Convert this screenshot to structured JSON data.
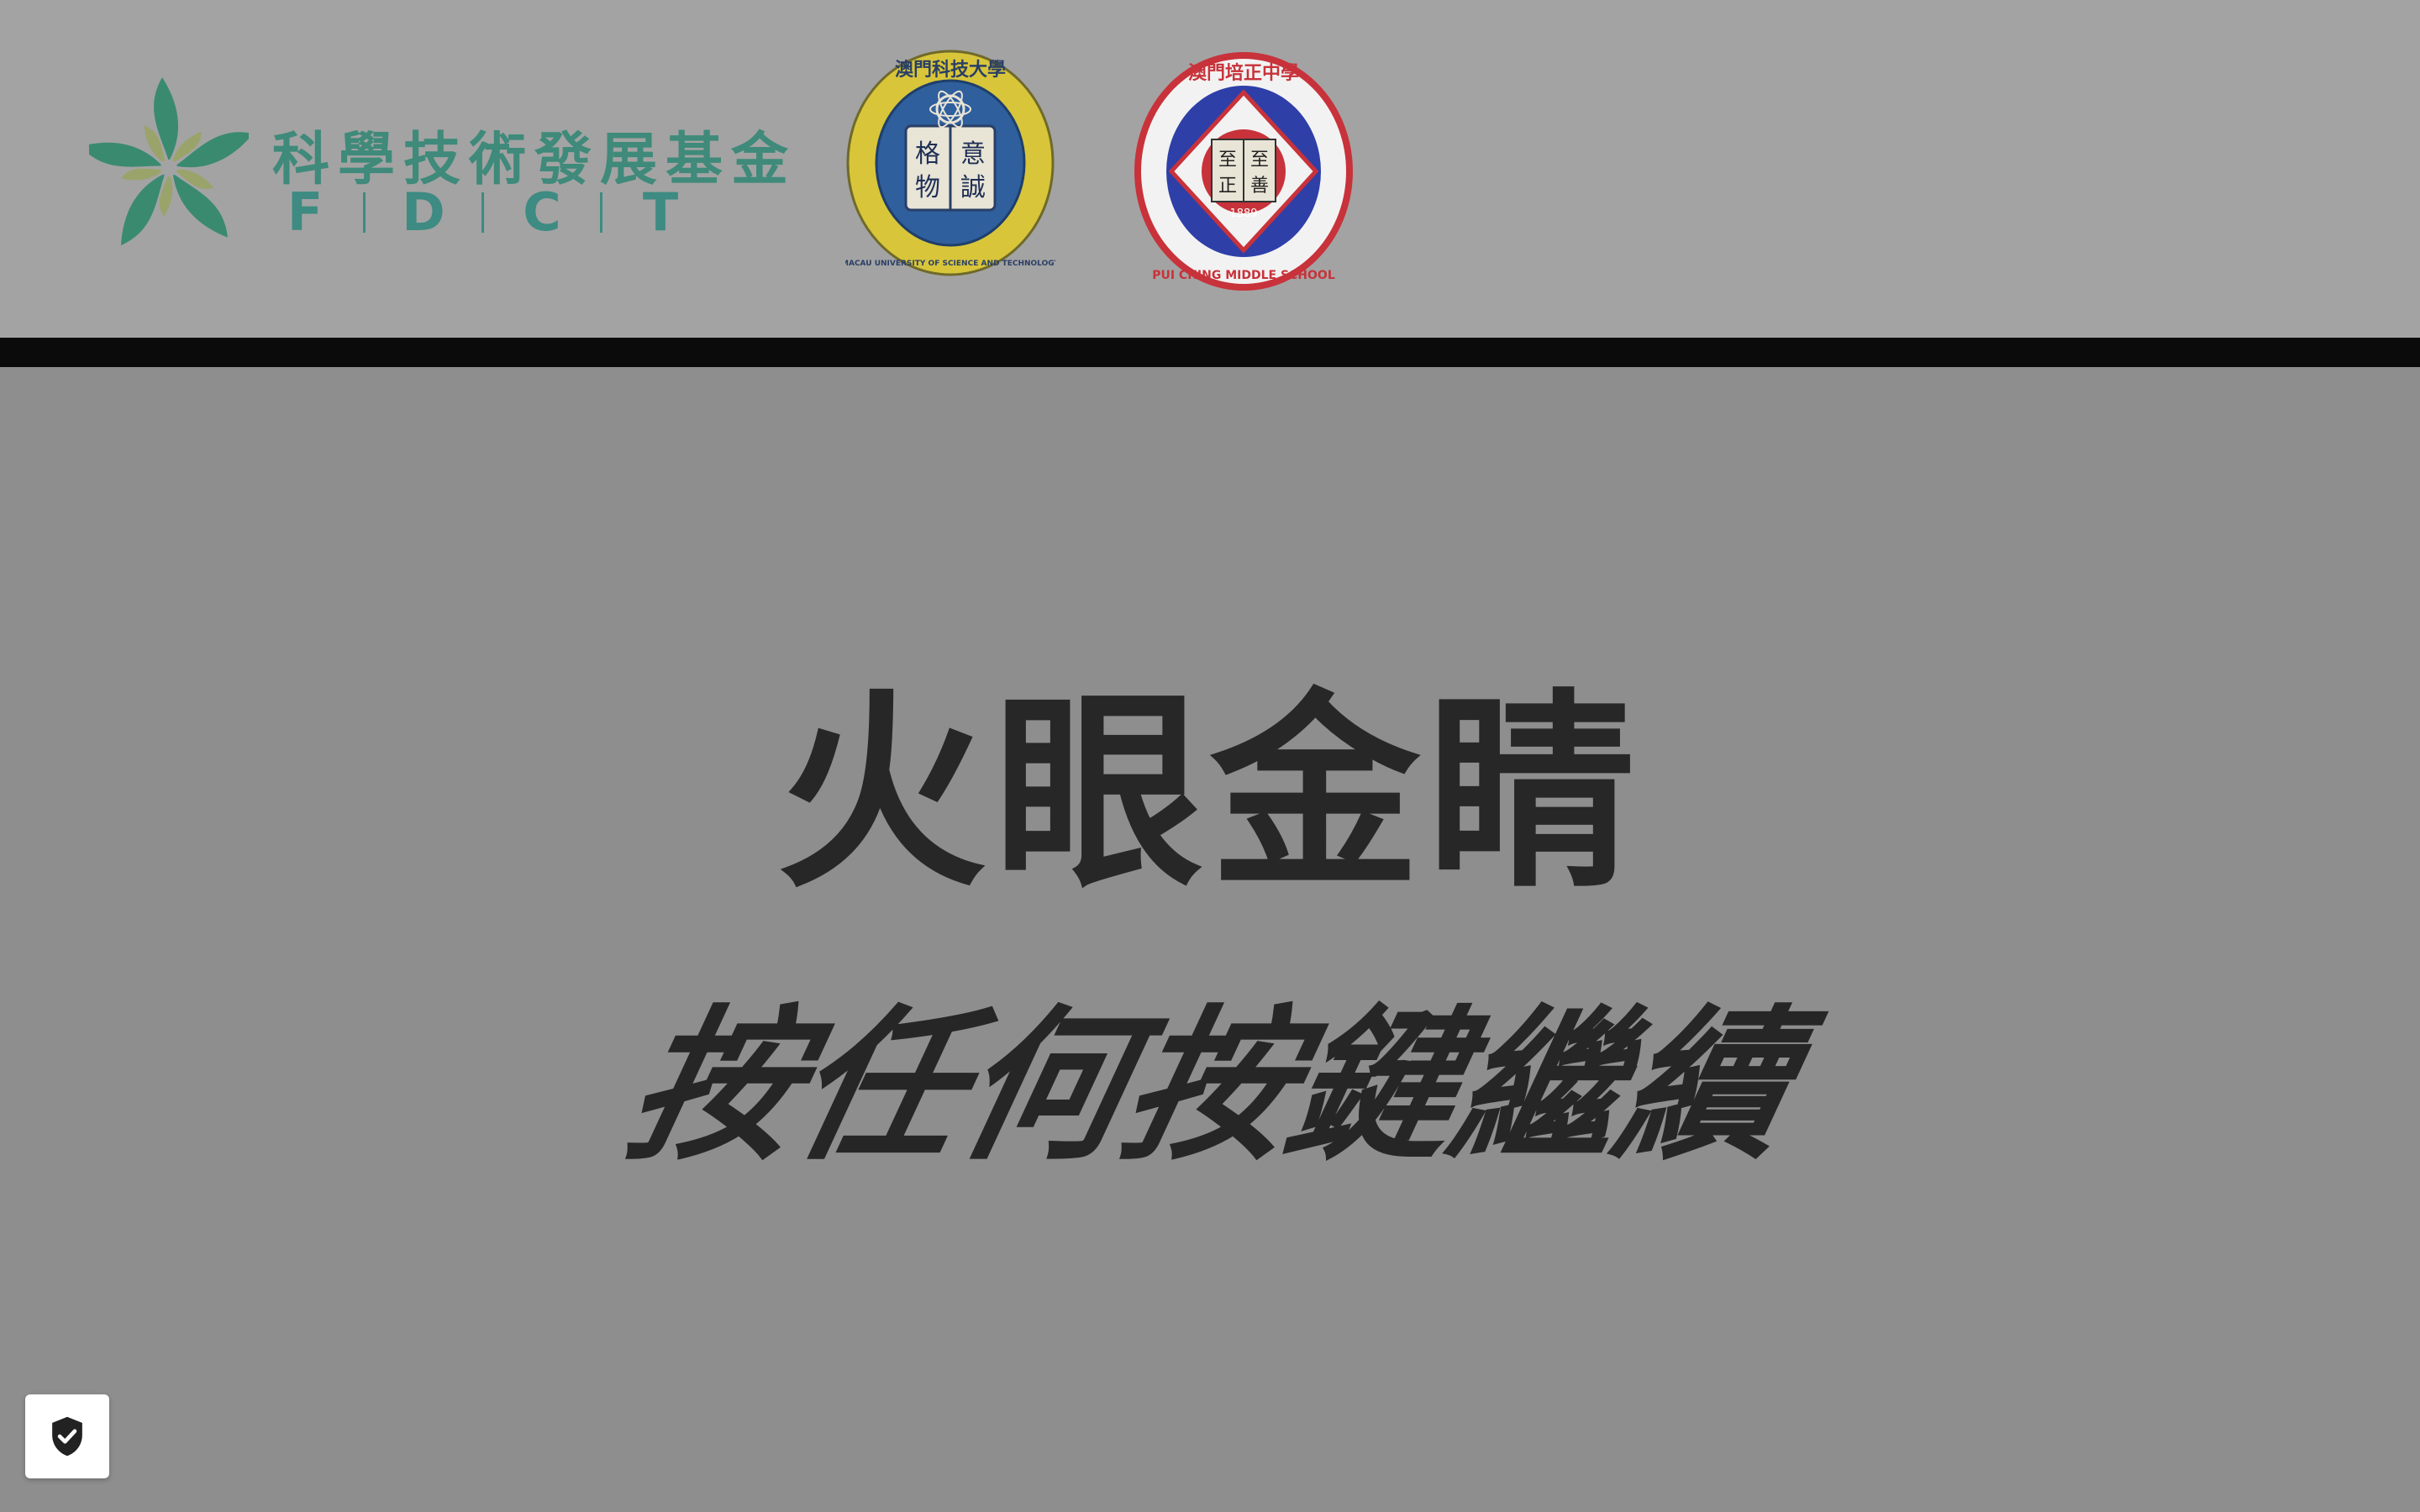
{
  "header": {
    "fdct_logo": {
      "name": "科學技術發展基金",
      "abbr_letters": [
        "F",
        "D",
        "C",
        "T"
      ],
      "color": "#3f8a7a"
    },
    "must_seal": {
      "ring_text": "澳門科技大學",
      "motto": [
        "格",
        "意",
        "物",
        "誠"
      ],
      "english_ring": "MACAU UNIVERSITY OF SCIENCE AND TECHNOLOGY",
      "colors": {
        "ring": "#d8c53a",
        "center": "#2f5f9c"
      }
    },
    "puiching_seal": {
      "ring_text": "澳門培正中學",
      "english_ring": "PUI CHING MIDDLE SCHOOL",
      "center_chars": [
        "至",
        "至",
        "正",
        "善"
      ],
      "year": "1889",
      "colors": {
        "ring": "#c8323a",
        "diamond": "#2e3fa8"
      }
    }
  },
  "main": {
    "title": "火眼金睛",
    "prompt": "按任何按鍵繼續"
  },
  "security_badge": {
    "icon": "shield-check-icon"
  }
}
